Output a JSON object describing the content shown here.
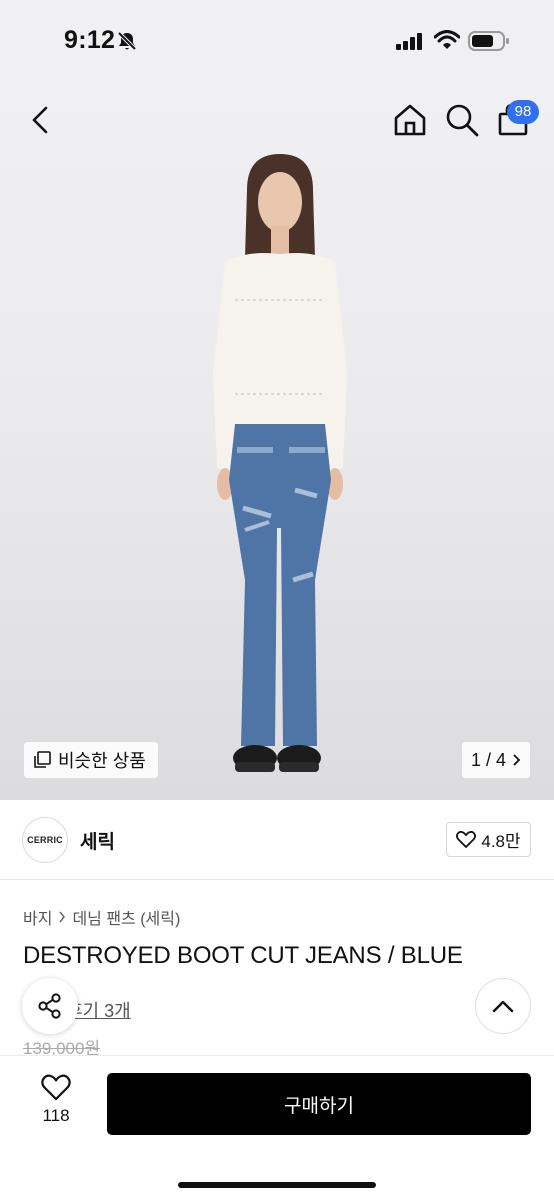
{
  "status_bar": {
    "time": "9:12"
  },
  "header": {
    "cart_count": "98"
  },
  "gallery": {
    "similar_label": "비슷한 상품",
    "page_indicator": "1 / 4"
  },
  "brand": {
    "logo_text": "CERRIC",
    "name": "세릭",
    "likes": "4.8만"
  },
  "product": {
    "breadcrumb": [
      "바지",
      "데님 팬츠 (세릭)"
    ],
    "title": "DESTROYED BOOT CUT JEANS / BLUE",
    "review_link": "후기 3개",
    "original_price": "139,000원"
  },
  "bottom_bar": {
    "wish_count": "118",
    "buy_label": "구매하기"
  },
  "colors": {
    "badge": "#2f6ff0",
    "buy_button": "#000000"
  }
}
